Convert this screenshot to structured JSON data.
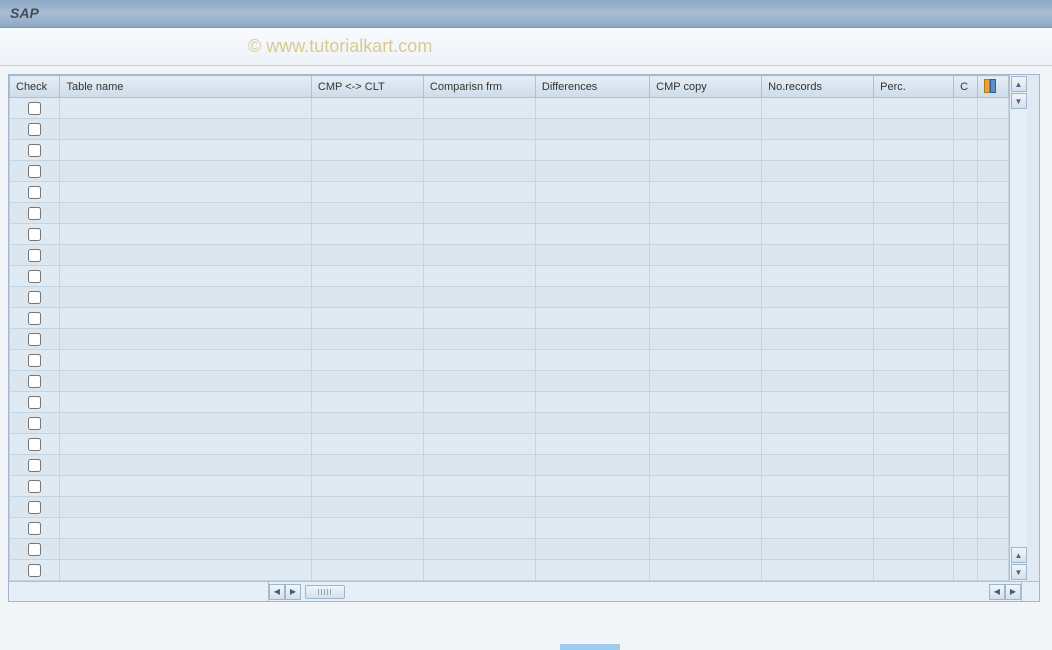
{
  "window": {
    "title": "SAP"
  },
  "watermark": "© www.tutorialkart.com",
  "grid": {
    "columns": [
      {
        "key": "check",
        "label": "Check"
      },
      {
        "key": "tablename",
        "label": "Table name"
      },
      {
        "key": "cmpclt",
        "label": "CMP <-> CLT"
      },
      {
        "key": "compfrm",
        "label": "Comparisn frm"
      },
      {
        "key": "diff",
        "label": "Differences"
      },
      {
        "key": "cmpcopy",
        "label": "CMP copy"
      },
      {
        "key": "norecords",
        "label": "No.records"
      },
      {
        "key": "perc",
        "label": "Perc."
      },
      {
        "key": "last",
        "label": "C"
      }
    ],
    "rows": [
      {},
      {},
      {},
      {},
      {},
      {},
      {},
      {},
      {},
      {},
      {},
      {},
      {},
      {},
      {},
      {},
      {},
      {},
      {},
      {},
      {},
      {},
      {}
    ]
  }
}
